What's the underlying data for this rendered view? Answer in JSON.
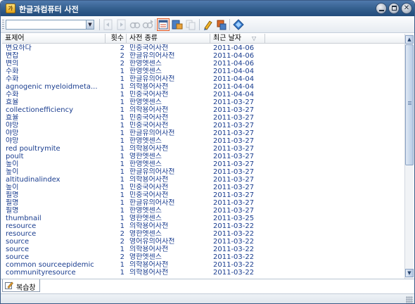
{
  "window": {
    "title": "한글과컴퓨터 사전",
    "app_icon_text": "가"
  },
  "toolbar": {
    "search_value": "",
    "tools": [
      {
        "name": "back-icon"
      },
      {
        "name": "forward-icon"
      },
      {
        "name": "find-icon"
      },
      {
        "name": "find-next-icon"
      },
      {
        "name": "list-view-icon"
      },
      {
        "name": "wordbook-icon"
      },
      {
        "name": "copy-icon"
      },
      {
        "name": "marker-icon"
      },
      {
        "name": "stamp-icon"
      },
      {
        "name": "settings-icon"
      }
    ]
  },
  "list": {
    "columns": {
      "word": "표제어",
      "count": "횟수",
      "dict": "사전 종류",
      "date": "최근 날자"
    },
    "sort_indicator": "▽",
    "rows": [
      {
        "word": "변요하다",
        "count": "2",
        "dict": "민중국어사전",
        "date": "2011-04-06"
      },
      {
        "word": "변잡",
        "count": "2",
        "dict": "한글유의어사전",
        "date": "2011-04-06"
      },
      {
        "word": "변의",
        "count": "2",
        "dict": "한영엣센스",
        "date": "2011-04-06"
      },
      {
        "word": "수화",
        "count": "1",
        "dict": "한영엣센스",
        "date": "2011-04-04"
      },
      {
        "word": "수화",
        "count": "1",
        "dict": "한글유의어사전",
        "date": "2011-04-04"
      },
      {
        "word": "agnogenic myeloidmeta...",
        "count": "1",
        "dict": "의학용어사전",
        "date": "2011-04-04"
      },
      {
        "word": "수화",
        "count": "1",
        "dict": "민중국어사전",
        "date": "2011-04-04"
      },
      {
        "word": "효율",
        "count": "1",
        "dict": "한영엣센스",
        "date": "2011-03-27"
      },
      {
        "word": "collectionefficiency",
        "count": "1",
        "dict": "의학용어사전",
        "date": "2011-03-27"
      },
      {
        "word": "효율",
        "count": "1",
        "dict": "민중국어사전",
        "date": "2011-03-27"
      },
      {
        "word": "야망",
        "count": "1",
        "dict": "민중국어사전",
        "date": "2011-03-27"
      },
      {
        "word": "야망",
        "count": "1",
        "dict": "한글유의어사전",
        "date": "2011-03-27"
      },
      {
        "word": "야망",
        "count": "1",
        "dict": "한영엣센스",
        "date": "2011-03-27"
      },
      {
        "word": "red poultrymite",
        "count": "1",
        "dict": "의학용어사전",
        "date": "2011-03-27"
      },
      {
        "word": "poult",
        "count": "1",
        "dict": "영한엣센스",
        "date": "2011-03-27"
      },
      {
        "word": "높이",
        "count": "1",
        "dict": "한영엣센스",
        "date": "2011-03-27"
      },
      {
        "word": "높이",
        "count": "1",
        "dict": "한글유의어사전",
        "date": "2011-03-27"
      },
      {
        "word": "altitudinalindex",
        "count": "1",
        "dict": "의학용어사전",
        "date": "2011-03-27"
      },
      {
        "word": "높이",
        "count": "1",
        "dict": "민중국어사전",
        "date": "2011-03-27"
      },
      {
        "word": "필명",
        "count": "1",
        "dict": "민중국어사전",
        "date": "2011-03-27"
      },
      {
        "word": "필명",
        "count": "1",
        "dict": "한글유의어사전",
        "date": "2011-03-27"
      },
      {
        "word": "필명",
        "count": "1",
        "dict": "한영엣센스",
        "date": "2011-03-27"
      },
      {
        "word": "thumbnail",
        "count": "1",
        "dict": "영한엣센스",
        "date": "2011-03-25"
      },
      {
        "word": "resource",
        "count": "1",
        "dict": "의학용어사전",
        "date": "2011-03-22"
      },
      {
        "word": "resource",
        "count": "2",
        "dict": "영한엣센스",
        "date": "2011-03-22"
      },
      {
        "word": "source",
        "count": "2",
        "dict": "영어유의어사전",
        "date": "2011-03-22"
      },
      {
        "word": "source",
        "count": "1",
        "dict": "의학용어사전",
        "date": "2011-03-22"
      },
      {
        "word": "source",
        "count": "2",
        "dict": "영한엣센스",
        "date": "2011-03-22"
      },
      {
        "word": "common sourceepidemic",
        "count": "1",
        "dict": "의학용어사전",
        "date": "2011-03-22"
      },
      {
        "word": "communityresource",
        "count": "1",
        "dict": "의학용어사전",
        "date": "2011-03-22"
      }
    ]
  },
  "tabs": [
    {
      "label": "복습창"
    }
  ],
  "colors": {
    "titlebar": "#35608f",
    "row_text": "#1a3d8f",
    "active_tool_border": "#e35d2a"
  }
}
